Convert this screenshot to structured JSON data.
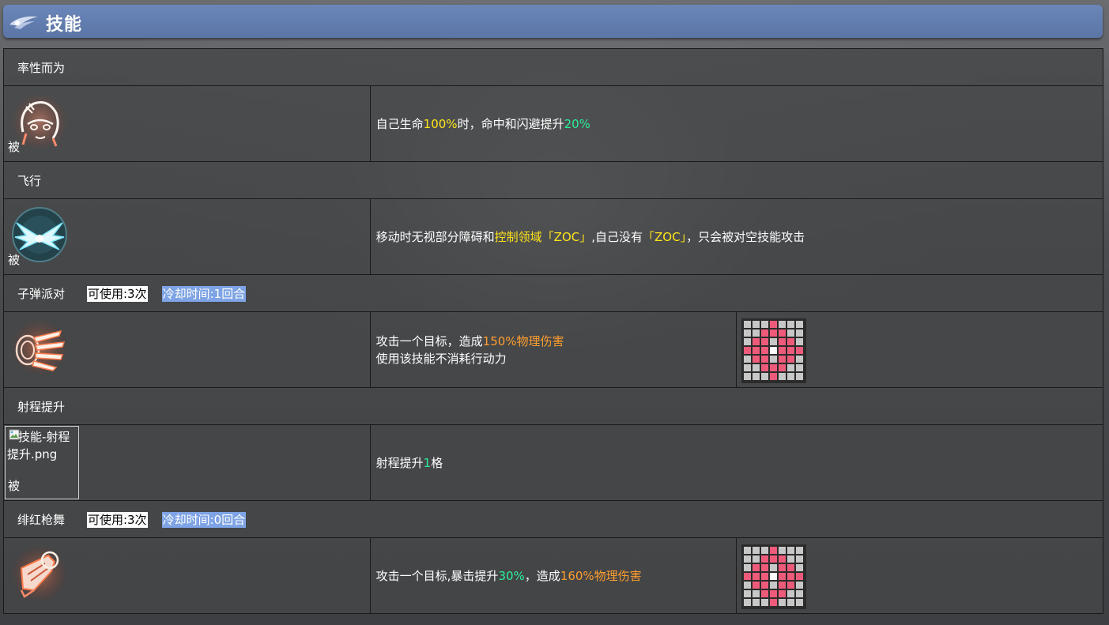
{
  "header": {
    "title": "技能"
  },
  "skills": [
    {
      "name": "率性而为",
      "passive_label": "被",
      "icon": "girl-face-icon",
      "desc": [
        {
          "t": "自己生命"
        },
        {
          "t": "100%",
          "c": "y"
        },
        {
          "t": "时，命中和闪避提升"
        },
        {
          "t": "20%",
          "c": "g"
        }
      ]
    },
    {
      "name": "飞行",
      "passive_label": "被",
      "icon": "wings-icon",
      "desc": [
        {
          "t": "移动时无视部分障碍和"
        },
        {
          "t": "控制领域「ZOC」",
          "c": "y"
        },
        {
          "t": ",自己没有"
        },
        {
          "t": "「ZOC」",
          "c": "y"
        },
        {
          "t": "，只会被对空技能攻击"
        }
      ]
    },
    {
      "name": "子弹派对",
      "uses": "可使用:3次",
      "cooldown": "冷却时间:1回合",
      "icon": "bullet-party-icon",
      "desc_lines": [
        [
          {
            "t": "攻击一个目标，造成"
          },
          {
            "t": "150%物理伤害",
            "c": "o"
          }
        ],
        [
          {
            "t": "使用该技能不消耗行动力"
          }
        ]
      ],
      "range_icon": "attack-range-grid-icon"
    },
    {
      "name": "射程提升",
      "passive_label": "被",
      "broken_image_alt": "技能-射程提升.png",
      "icon": "broken-image-icon",
      "desc": [
        {
          "t": "射程提升"
        },
        {
          "t": "1",
          "c": "g"
        },
        {
          "t": "格"
        }
      ]
    },
    {
      "name": "绯红枪舞",
      "uses": "可使用:3次",
      "cooldown": "冷却时间:0回合",
      "icon": "crimson-gun-dance-icon",
      "desc": [
        {
          "t": "攻击一个目标,暴击提升"
        },
        {
          "t": "30%",
          "c": "g"
        },
        {
          "t": "，造成"
        },
        {
          "t": "160%物理伤害",
          "c": "o"
        }
      ],
      "range_icon": "attack-range-grid-icon"
    }
  ],
  "colors": {
    "header": "#5f7aac",
    "yellow": "#ffe51a",
    "green": "#2bf09a",
    "orange": "#ff9e2e",
    "cooldown_bg": "#7ea3e6"
  }
}
